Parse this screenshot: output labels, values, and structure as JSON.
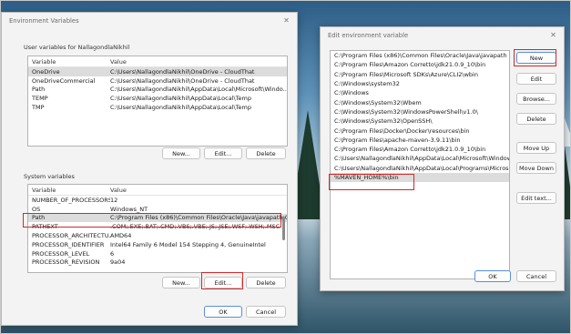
{
  "env_dialog": {
    "title": "Environment Variables",
    "user_section_label": "User variables for NallagondlaNikhil",
    "columns": [
      "Variable",
      "Value"
    ],
    "user_vars": [
      {
        "name": "OneDrive",
        "value": "C:\\Users\\NallagondlaNikhil\\OneDrive - CloudThat"
      },
      {
        "name": "OneDriveCommercial",
        "value": "C:\\Users\\NallagondlaNikhil\\OneDrive - CloudThat"
      },
      {
        "name": "Path",
        "value": "C:\\Users\\NallagondlaNikhil\\AppData\\Local\\Microsoft\\Windo..."
      },
      {
        "name": "TEMP",
        "value": "C:\\Users\\NallagondlaNikhil\\AppData\\Local\\Temp"
      },
      {
        "name": "TMP",
        "value": "C:\\Users\\NallagondlaNikhil\\AppData\\Local\\Temp"
      }
    ],
    "user_buttons": {
      "new": "New...",
      "edit": "Edit...",
      "delete": "Delete"
    },
    "system_section_label": "System variables",
    "system_vars": [
      {
        "name": "NUMBER_OF_PROCESSORS",
        "value": "12"
      },
      {
        "name": "OS",
        "value": "Windows_NT"
      },
      {
        "name": "Path",
        "value": "C:\\Program Files (x86)\\Common Files\\Oracle\\Java\\javapath;C..."
      },
      {
        "name": "PATHEXT",
        "value": ".COM;.EXE;.BAT;.CMD;.VBS;.VBE;.JS;.JSE;.WSF;.WSH;.MSC"
      },
      {
        "name": "PROCESSOR_ARCHITECTU...",
        "value": "AMD64"
      },
      {
        "name": "PROCESSOR_IDENTIFIER",
        "value": "Intel64 Family 6 Model 154 Stepping 4, GenuineIntel"
      },
      {
        "name": "PROCESSOR_LEVEL",
        "value": "6"
      },
      {
        "name": "PROCESSOR_REVISION",
        "value": "9a04"
      }
    ],
    "system_buttons": {
      "new": "New...",
      "edit": "Edit...",
      "delete": "Delete"
    },
    "ok": "OK",
    "cancel": "Cancel"
  },
  "edit_dialog": {
    "title": "Edit environment variable",
    "paths": [
      "C:\\Program Files (x86)\\Common Files\\Oracle\\Java\\javapath",
      "C:\\Program Files\\Amazon Corretto\\jdk21.0.9_10\\bin",
      "C:\\Program Files\\Microsoft SDKs\\Azure\\CLI2\\wbin",
      "C:\\Windows\\system32",
      "C:\\Windows",
      "C:\\Windows\\System32\\Wbem",
      "C:\\Windows\\System32\\WindowsPowerShell\\v1.0\\",
      "C:\\Windows\\System32\\OpenSSH\\",
      "C:\\Program Files\\Docker\\Docker\\resources\\bin",
      "C:\\Program Files\\apache-maven-3.9.11\\bin",
      "C:\\Program Files\\Amazon Corretto\\jdk21.0.9_10\\bin",
      "C:\\Users\\NallagondlaNikhil\\AppData\\Local\\Microsoft\\Windows...",
      "C:\\Users\\NallagondlaNikhil\\AppData\\Local\\Programs\\Microsoft...",
      "%MAVEN_HOME%\\bin"
    ],
    "buttons": {
      "new": "New",
      "edit": "Edit",
      "browse": "Browse...",
      "delete": "Delete",
      "move_up": "Move Up",
      "move_down": "Move Down",
      "edit_text": "Edit text..."
    },
    "ok": "OK",
    "cancel": "Cancel"
  },
  "colors": {
    "highlight": "#d12a2a",
    "selection": "#dcdcdc",
    "accent": "#5a8fd8"
  }
}
